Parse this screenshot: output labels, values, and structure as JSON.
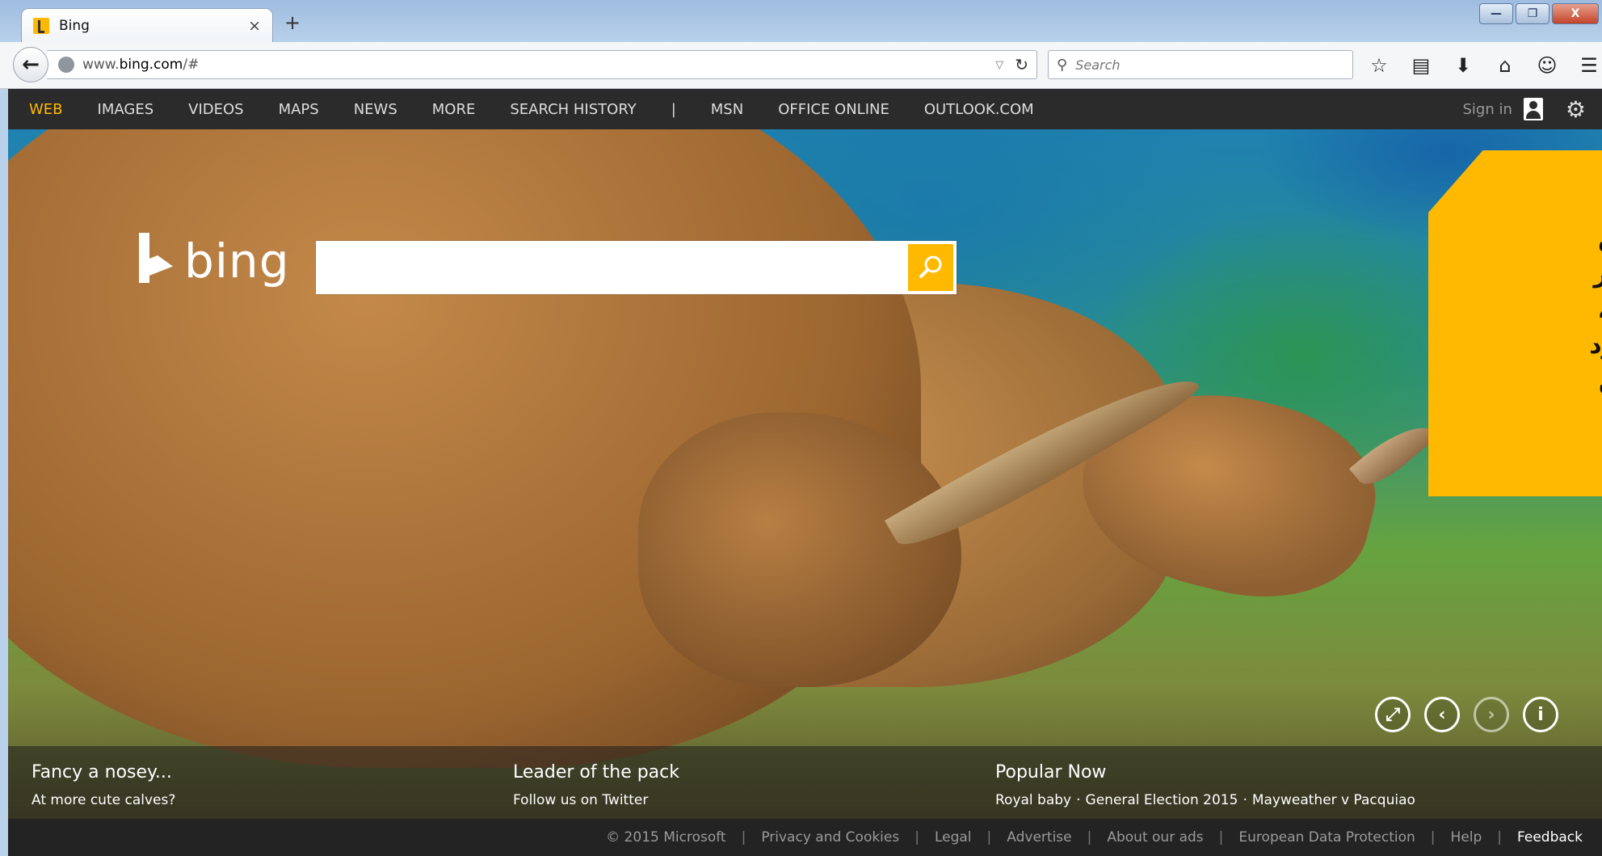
{
  "browser": {
    "tab_title": "Bing",
    "tab_close": "×",
    "new_tab": "+",
    "url_prefix": "www.",
    "url_domain": "bing.com",
    "url_suffix": "/#",
    "search_placeholder": "Search",
    "window_controls": {
      "minimize": "—",
      "maximize": "❐",
      "close": "X"
    },
    "toolbar_icons": [
      "star-icon",
      "reading-list-icon",
      "download-icon",
      "home-icon",
      "chat-icon",
      "menu-icon"
    ]
  },
  "bing_nav": {
    "items": [
      {
        "label": "WEB",
        "active": true
      },
      {
        "label": "IMAGES"
      },
      {
        "label": "VIDEOS"
      },
      {
        "label": "MAPS"
      },
      {
        "label": "NEWS"
      },
      {
        "label": "MORE"
      },
      {
        "label": "SEARCH HISTORY"
      }
    ],
    "divider": "|",
    "external": [
      {
        "label": "MSN"
      },
      {
        "label": "OFFICE ONLINE"
      },
      {
        "label": "OUTLOOK.COM"
      }
    ],
    "sign_in": "Sign in"
  },
  "hero": {
    "logo_text": "bing",
    "search_value": ""
  },
  "callout": {
    "lines": [
      "\" محصول",
      "ت و تلاش",
      "متفاوت از",
      "ک هنري)،",
      "ی خود گرد",
      "نیز در این"
    ]
  },
  "tiles": [
    {
      "title": "Fancy a nosey...",
      "subtitle": "At more cute calves?"
    },
    {
      "title": "Leader of the pack",
      "subtitle": "Follow us on Twitter"
    },
    {
      "title": "Popular Now",
      "trends": [
        "Royal baby",
        "General Election 2015",
        "Mayweather v Pacquiao"
      ],
      "trend_sep": "·"
    }
  ],
  "footer": {
    "copyright": "© 2015 Microsoft",
    "links": [
      "Privacy and Cookies",
      "Legal",
      "Advertise",
      "About our ads",
      "European Data Protection",
      "Help"
    ],
    "feedback": "Feedback"
  },
  "colors": {
    "accent": "#ffb900",
    "nav_bg": "#2b2b2b",
    "footer_bg": "#232323"
  }
}
